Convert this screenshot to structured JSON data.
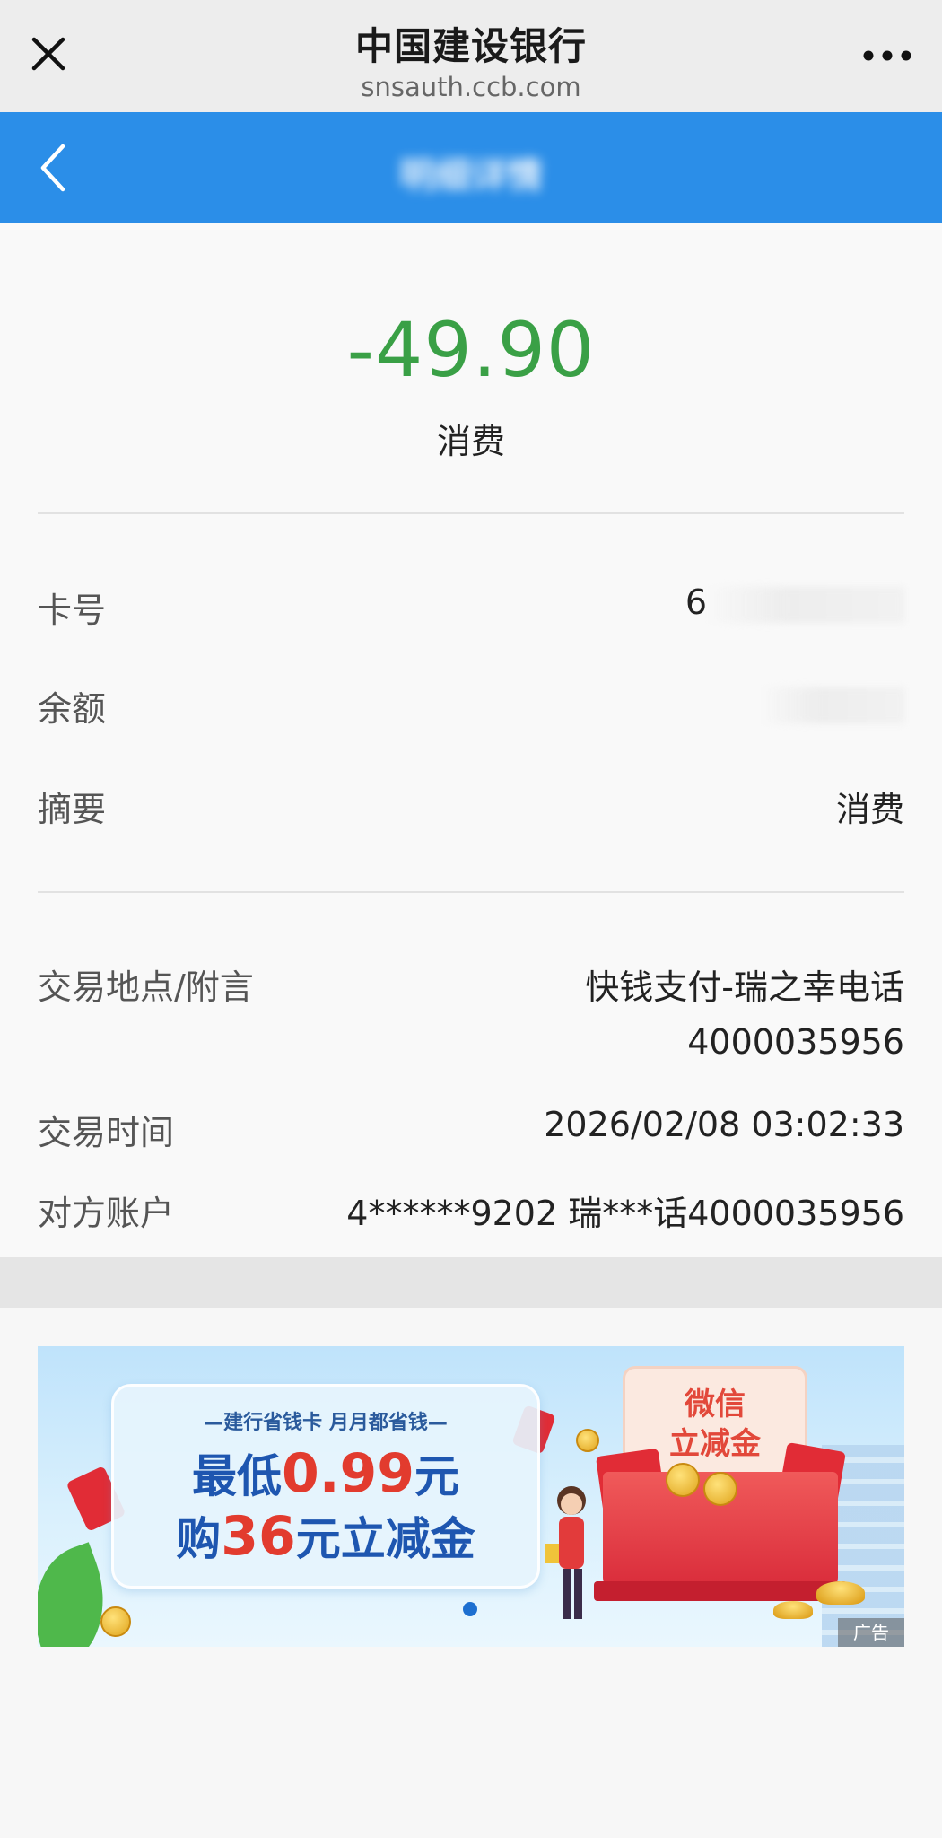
{
  "browser": {
    "site_name": "中国建设银行",
    "url": "snsauth.ccb.com"
  },
  "header": {
    "title_blurred": "明细详情"
  },
  "transaction": {
    "amount": "-49.90",
    "type": "消费",
    "amount_color": "#3aa046"
  },
  "details": {
    "card_label": "卡号",
    "card_value_visible": "6",
    "balance_label": "余额",
    "summary_label": "摘要",
    "summary_value": "消费",
    "location_label": "交易地点/附言",
    "location_value_line1": "快钱支付-瑞之幸电话",
    "location_value_line2": "4000035956",
    "time_label": "交易时间",
    "time_value": "2026/02/08 03:02:33",
    "counterparty_label": "对方账户",
    "counterparty_value": "4******9202 瑞***话4000035956"
  },
  "ad": {
    "subtitle": "—建行省钱卡 月月都省钱—",
    "line1_prefix": "最低",
    "line1_highlight": "0.99",
    "line1_suffix": "元",
    "line2_prefix": "购",
    "line2_highlight": "36",
    "line2_suffix": "元立减金",
    "promo_line1": "微信",
    "promo_line2": "立减金",
    "tag": "广告"
  },
  "colors": {
    "header_blue": "#2b8ee8",
    "ad_red": "#e23b2e",
    "ad_blue": "#1e56b0"
  },
  "icons": [
    "close-icon",
    "more-icon",
    "back-arrow-icon"
  ]
}
